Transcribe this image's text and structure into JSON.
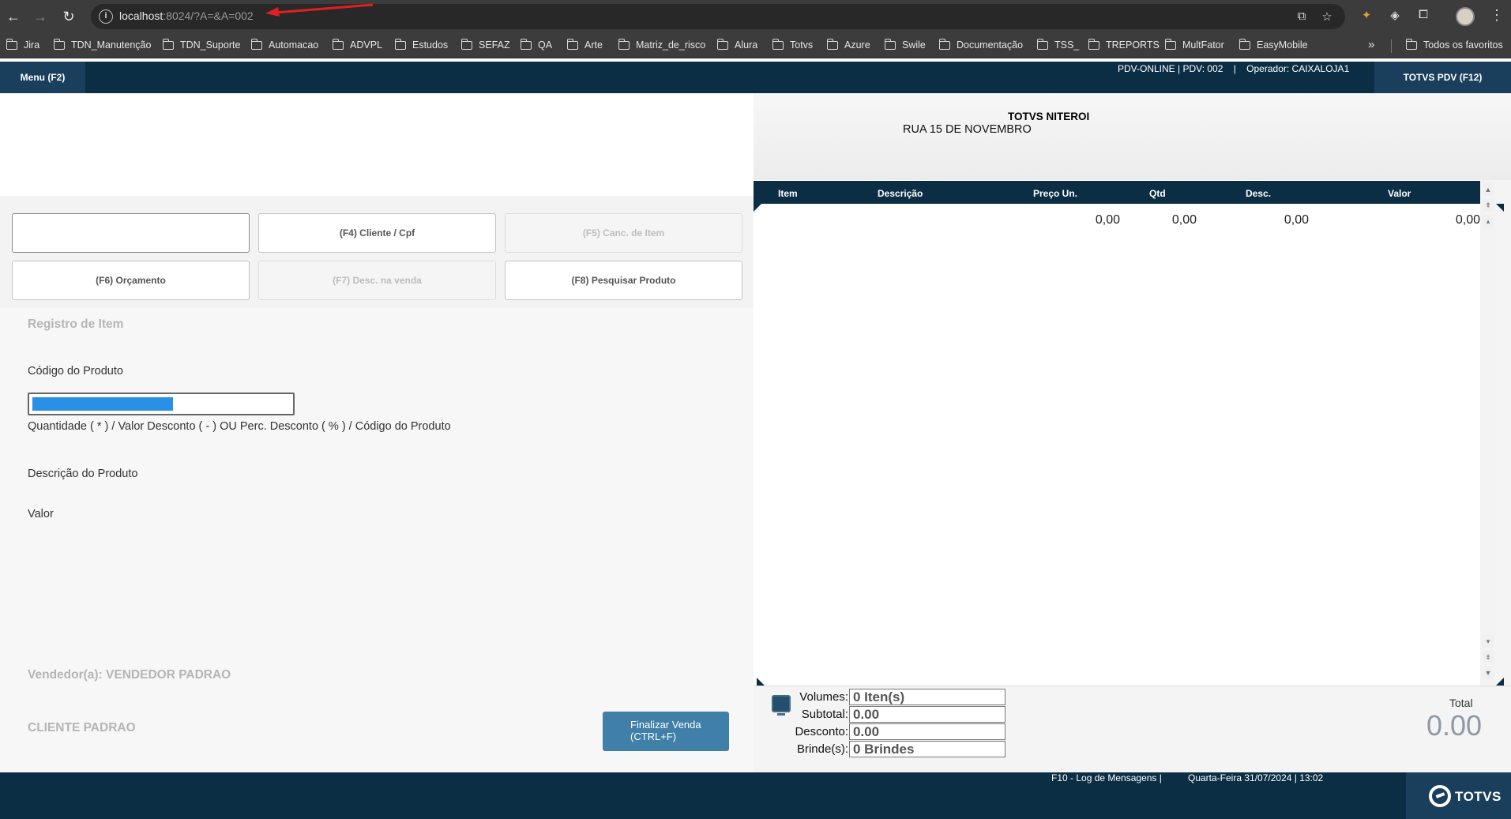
{
  "browser": {
    "url_host": "localhost",
    "url_rest": ":8024/?A=&A=002",
    "bookmarks": [
      "Jira",
      "TDN_Manutenção",
      "TDN_Suporte",
      "Automacao",
      "ADVPL",
      "Estudos",
      "SEFAZ",
      "QA",
      "Arte",
      "Matriz_de_risco",
      "Alura",
      "Totvs",
      "Azure",
      "Swile",
      "Documentação",
      "TSS_",
      "TREPORTS",
      "MultFator",
      "EasyMobile"
    ],
    "more_bookmarks": "»",
    "all_favorites": "Todos os favoritos"
  },
  "header": {
    "menu_label": "Menu (F2)",
    "info": "PDV-ONLINE | PDV: 002    |    Operador: CAIXALOJA1",
    "pdv_label": "TOTVS PDV (F12)"
  },
  "buttons": {
    "blank": "",
    "cliente": "(F4) Cliente / Cpf",
    "canc_item": "(F5) Canc. de Item",
    "orcamento": "(F6) Orçamento",
    "desc_venda": "(F7) Desc. na venda",
    "pesquisar": "(F8) Pesquisar Produto"
  },
  "form": {
    "section_title": "Registro de Item",
    "code_label": "Código do Produto",
    "code_hint": "Quantidade ( * ) / Valor Desconto ( - ) OU Perc. Desconto ( % ) / Código do Produto",
    "desc_label": "Descrição do Produto",
    "value_label": "Valor",
    "seller": "Vendedor(a): VENDEDOR PADRAO",
    "customer": "CLIENTE PADRAO",
    "finalize_line1": "Finalizar Venda",
    "finalize_line2": "(CTRL+F)"
  },
  "store": {
    "name": "TOTVS NITEROI",
    "address": "RUA 15 DE NOVEMBRO"
  },
  "table": {
    "headers": [
      "Item",
      "Descrição",
      "Preço Un.",
      "Qtd",
      "Desc.",
      "Valor"
    ],
    "row": {
      "preco": "0,00",
      "qtd": "0,00",
      "desc": "0,00",
      "valor": "0,00"
    }
  },
  "summary": {
    "volumes_label": "Volumes:",
    "volumes_value": "0 Iten(s)",
    "subtotal_label": "Subtotal:",
    "subtotal_value": "0.00",
    "desconto_label": "Desconto:",
    "desconto_value": "0.00",
    "brindes_label": "Brinde(s):",
    "brindes_value": "0 Brindes",
    "total_label": "Total",
    "total_value": "0.00"
  },
  "status": {
    "log": "F10 - Log de Mensagens |",
    "datetime": "Quarta-Feira 31/07/2024 | 13:02",
    "brand": "TOTVS"
  },
  "colors": {
    "header_bg": "#0b2e45",
    "accent_button": "#3f7fa8",
    "selection": "#2a90e5",
    "annotation_arrow": "#e02020"
  }
}
